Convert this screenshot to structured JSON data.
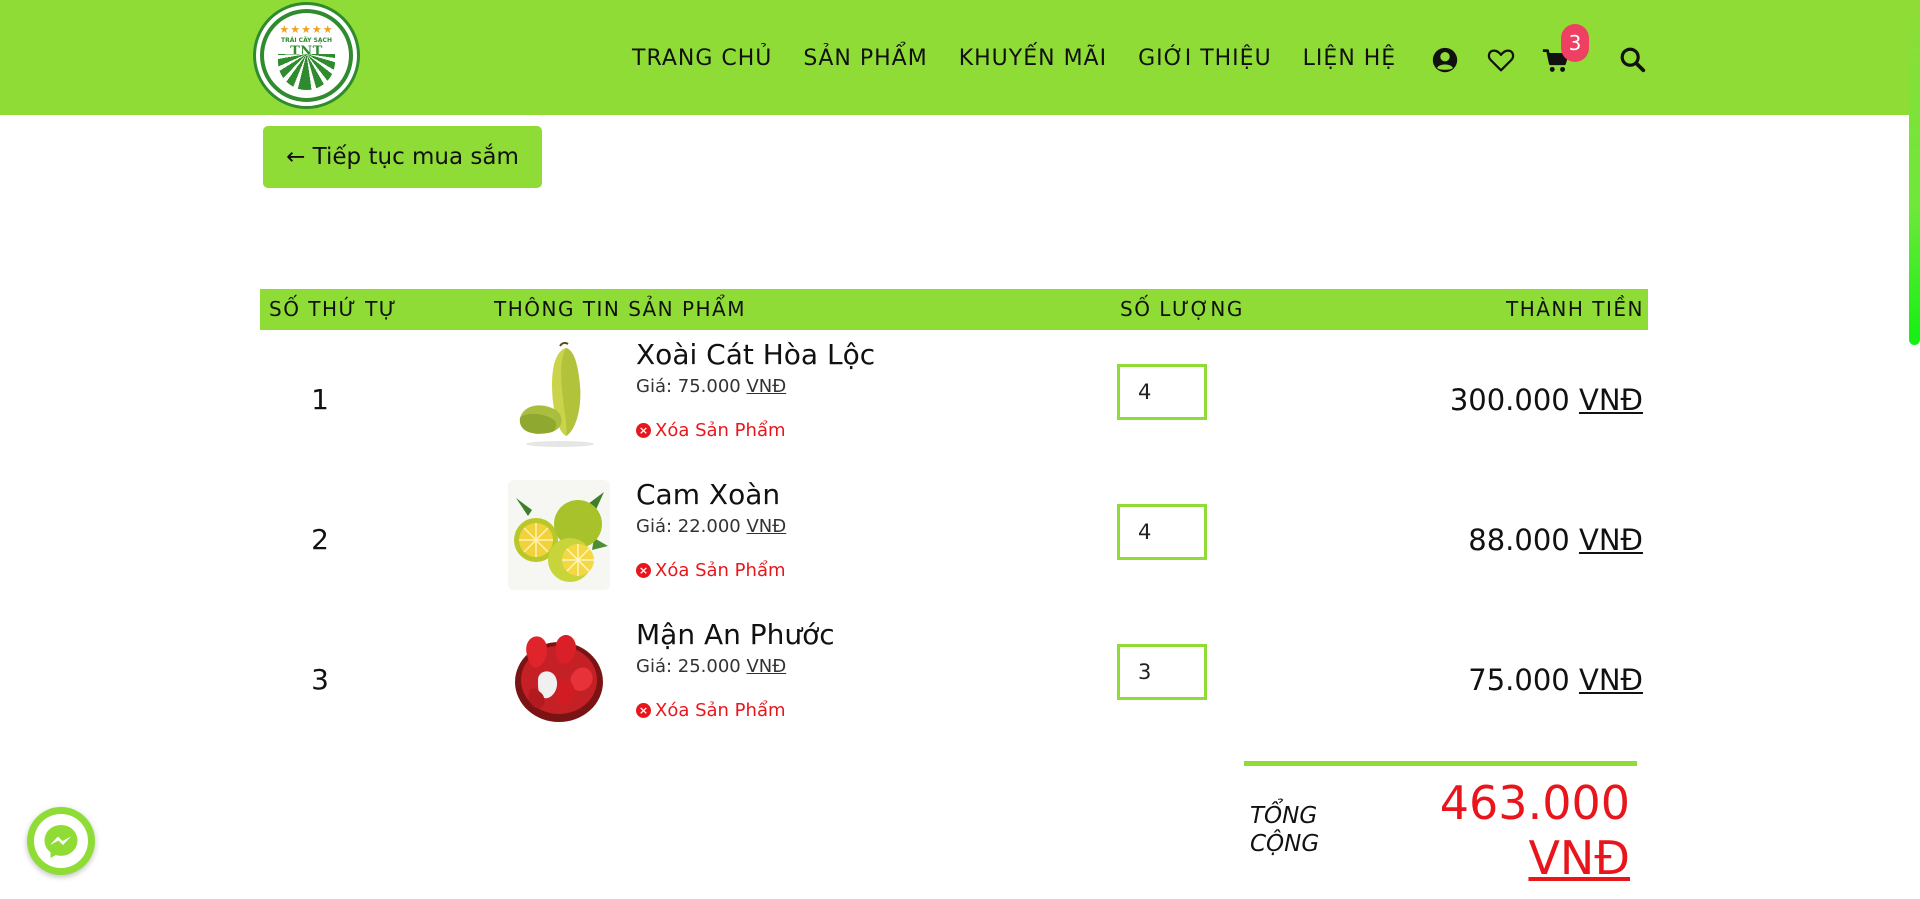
{
  "header": {
    "logo": {
      "small_text": "TRÁI CÂY SẠCH",
      "brand": "TNT FRUIT"
    },
    "nav": [
      "TRANG CHỦ",
      "SẢN PHẨM",
      "KHUYẾN MÃI",
      "GIỚI THIỆU",
      "LIỆN HỆ"
    ],
    "cart_count": "3"
  },
  "continue_shopping": "← Tiếp tục mua sắm",
  "table": {
    "headers": {
      "index": "SỐ THỨ TỰ",
      "product": "THÔNG TIN SẢN PHẨM",
      "quantity": "SỐ LƯỢNG",
      "subtotal": "THÀNH TIỀN"
    },
    "rows": [
      {
        "index": "1",
        "name": "Xoài Cát Hòa Lộc",
        "price_label": "Giá: 75.000",
        "currency": "VNĐ",
        "remove": "Xóa Sản Phẩm",
        "quantity": "4",
        "subtotal": "300.000",
        "image": "mango"
      },
      {
        "index": "2",
        "name": "Cam Xoàn",
        "price_label": "Giá: 22.000",
        "currency": "VNĐ",
        "remove": "Xóa Sản Phẩm",
        "quantity": "4",
        "subtotal": "88.000",
        "image": "orange"
      },
      {
        "index": "3",
        "name": "Mận An Phước",
        "price_label": "Giá: 25.000",
        "currency": "VNĐ",
        "remove": "Xóa Sản Phẩm",
        "quantity": "3",
        "subtotal": "75.000",
        "image": "rose-apple"
      }
    ]
  },
  "total": {
    "label_line1": "TỔNG",
    "label_line2": "CỘNG",
    "value": "463.000",
    "currency": "VNĐ"
  },
  "colors": {
    "brand_green": "#8fdc36",
    "price_red": "#e8161c",
    "badge_pink": "#ef3f62"
  },
  "icons": [
    "user-icon",
    "heart-icon",
    "cart-icon",
    "search-icon",
    "messenger-icon",
    "remove-icon"
  ]
}
